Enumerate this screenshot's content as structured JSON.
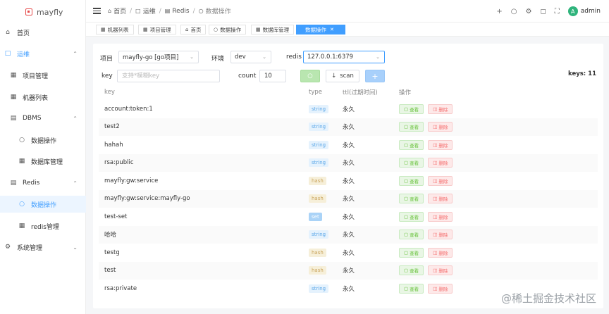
{
  "app": {
    "name": "mayfly"
  },
  "sidebar": {
    "items": [
      {
        "label": "首页",
        "icon": "home-icon"
      },
      {
        "label": "运维",
        "icon": "monitor-icon"
      },
      {
        "label": "项目管理",
        "icon": "grid-icon"
      },
      {
        "label": "机器列表",
        "icon": "grid-icon"
      },
      {
        "label": "DBMS",
        "icon": "database-icon"
      },
      {
        "label": "数据操作",
        "icon": "search-icon"
      },
      {
        "label": "数据库管理",
        "icon": "grid-icon"
      },
      {
        "label": "Redis",
        "icon": "database-icon"
      },
      {
        "label": "数据操作",
        "icon": "search-icon"
      },
      {
        "label": "redis管理",
        "icon": "grid-icon"
      },
      {
        "label": "系统管理",
        "icon": "gear-icon"
      }
    ],
    "accent": "#409eff"
  },
  "breadcrumb": [
    "首页",
    "运维",
    "Redis",
    "数据操作"
  ],
  "header": {
    "user": "admin",
    "avatar_letter": "A"
  },
  "tags": [
    {
      "label": "机器列表"
    },
    {
      "label": "项目管理"
    },
    {
      "label": "首页"
    },
    {
      "label": "数据操作"
    },
    {
      "label": "数据库管理"
    },
    {
      "label": "数据操作"
    }
  ],
  "filters": {
    "project_label": "项目",
    "project_value": "mayfly-go [go项目]",
    "env_label": "环境",
    "env_value": "dev",
    "redis_label": "redis",
    "redis_value": "127.0.0.1:6379",
    "key_label": "key",
    "key_placeholder": "支持*模糊key",
    "count_label": "count",
    "count_value": "10",
    "scan_label": "scan",
    "add_label": "+",
    "keys_count": "keys: 11"
  },
  "table": {
    "headers": {
      "key": "key",
      "type": "type",
      "ttl": "ttl(过期时间)",
      "ops": "操作"
    },
    "view_label": "查看",
    "delete_label": "删除",
    "rows": [
      {
        "key": "account:token:1",
        "type": "string",
        "ttl": "永久"
      },
      {
        "key": "test2",
        "type": "string",
        "ttl": "永久"
      },
      {
        "key": "hahah",
        "type": "string",
        "ttl": "永久"
      },
      {
        "key": "rsa:public",
        "type": "string",
        "ttl": "永久"
      },
      {
        "key": "mayfly:gw:service",
        "type": "hash",
        "ttl": "永久"
      },
      {
        "key": "mayfly:gw:service:mayfly-go",
        "type": "hash",
        "ttl": "永久"
      },
      {
        "key": "test-set",
        "type": "set",
        "ttl": "永久"
      },
      {
        "key": "哈哈",
        "type": "string",
        "ttl": "永久"
      },
      {
        "key": "testg",
        "type": "hash",
        "ttl": "永久"
      },
      {
        "key": "test",
        "type": "hash",
        "ttl": "永久"
      },
      {
        "key": "rsa:private",
        "type": "string",
        "ttl": "永久"
      }
    ]
  },
  "type_colors": {
    "string": {
      "bg": "#e5f2fd",
      "fg": "#5ba7e8"
    },
    "hash": {
      "bg": "#f6efd9",
      "fg": "#c9a35a"
    },
    "set": {
      "bg": "#aad3f7",
      "fg": "#ffffff"
    }
  },
  "watermark": "@稀土掘金技术社区"
}
